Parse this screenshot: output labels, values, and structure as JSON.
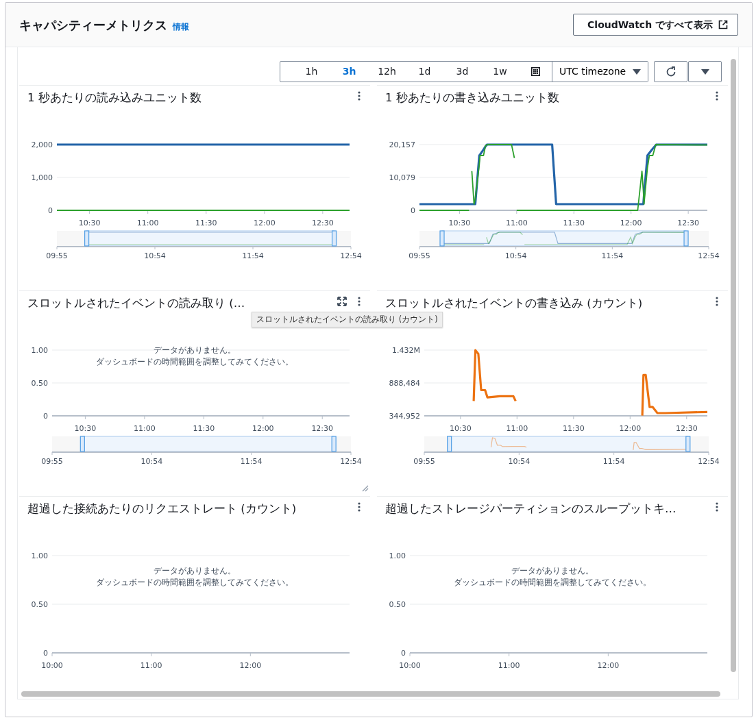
{
  "header": {
    "title": "キャパシティーメトリクス",
    "info_link": "情報",
    "cloudwatch_button": "CloudWatch ですべて表示"
  },
  "toolbar": {
    "ranges": [
      {
        "label": "1h",
        "selected": false
      },
      {
        "label": "3h",
        "selected": true
      },
      {
        "label": "12h",
        "selected": false
      },
      {
        "label": "1d",
        "selected": false
      },
      {
        "label": "3d",
        "selected": false
      },
      {
        "label": "1w",
        "selected": false
      }
    ],
    "timezone": "UTC timezone"
  },
  "widgets": [
    {
      "title": "1 秒あたりの読み込みユニット数",
      "hovered": false,
      "navigator_ticks": [
        "09:55",
        "10:54",
        "11:54",
        "12:54"
      ],
      "chart_data": {
        "type": "line",
        "x": [
          10.22,
          12.73
        ],
        "series": [
          {
            "color": "#2364a8",
            "values": [
              2000,
              2000
            ]
          },
          {
            "color": "#2ca02c",
            "values": [
              0,
              0
            ]
          }
        ],
        "xlim": [
          10.22,
          12.73
        ],
        "ylim": [
          0,
          2000
        ],
        "xticks": [
          {
            "value": 10.5,
            "label": "10:30"
          },
          {
            "value": 11,
            "label": "11:00"
          },
          {
            "value": 11.5,
            "label": "11:30"
          },
          {
            "value": 12,
            "label": "12:00"
          },
          {
            "value": 12.5,
            "label": "12:30"
          }
        ],
        "yticks": [
          {
            "value": 0,
            "label": "0"
          },
          {
            "value": 1000,
            "label": "1,000"
          },
          {
            "value": 2000,
            "label": "2,000"
          }
        ]
      }
    },
    {
      "title": "1 秒あたりの書き込みユニット数",
      "hovered": false,
      "navigator_ticks": [
        "09:55",
        "10:54",
        "11:54",
        "12:54"
      ],
      "chart_data": {
        "type": "line",
        "x": [
          10.15,
          10.583,
          10.597,
          10.608,
          10.627,
          10.638,
          10.673,
          10.68,
          10.71,
          10.728,
          10.74,
          10.745,
          10.917,
          10.955,
          10.98,
          10.992,
          11,
          11.31,
          11.345,
          12.058,
          12.095,
          12.107,
          12.113,
          12.143,
          12.16,
          12.19,
          12.217,
          12.22,
          12.667
        ],
        "series": [
          {
            "color": "#2364a8",
            "values": [
              1900,
              1900,
              1900,
              1900,
              1900,
              1900,
              16800,
              17100,
              18600,
              19600,
              20157,
              20157,
              20157,
              20157,
              20157,
              20157,
              20157,
              20157,
              1900,
              1900,
              1900,
              1900,
              4600,
              16800,
              17600,
              18900,
              20000,
              20157,
              20157
            ]
          },
          {
            "color": "#2ca02c",
            "values": [
              0,
              0,
              null,
              12000,
              1900,
              3500,
              14000,
              16800,
              16800,
              19800,
              20000,
              20157,
              20157,
              20157,
              16000,
              null,
              0,
              0,
              0,
              0,
              12000,
              6000,
              1900,
              13000,
              16800,
              16800,
              20157,
              20157,
              20000
            ]
          }
        ],
        "xlim": [
          10.15,
          12.667
        ],
        "ylim": [
          0,
          20157
        ],
        "xticks": [
          {
            "value": 10.5,
            "label": "10:30"
          },
          {
            "value": 11,
            "label": "11:00"
          },
          {
            "value": 11.5,
            "label": "11:30"
          },
          {
            "value": 12,
            "label": "12:00"
          },
          {
            "value": 12.5,
            "label": "12:30"
          }
        ],
        "yticks": [
          {
            "value": 0,
            "label": "0"
          },
          {
            "value": 10079,
            "label": "10,079"
          },
          {
            "value": 20157,
            "label": "20,157"
          }
        ]
      }
    },
    {
      "title": "スロットルされたイベントの読み取り (…",
      "hovered": true,
      "tooltip": "スロットルされたイベントの読み取り (カウント)",
      "navigator_ticks": [
        "09:55",
        "10:54",
        "11:54",
        "12:54"
      ],
      "no_data_message": [
        "データがありません。",
        "ダッシュボードの時間範囲を調整してみてください。"
      ],
      "chart_data": {
        "type": "line",
        "xlim": [
          10.22,
          12.73
        ],
        "ylim": [
          0,
          1
        ],
        "xticks": [
          {
            "value": 10.5,
            "label": "10:30"
          },
          {
            "value": 11,
            "label": "11:00"
          },
          {
            "value": 11.5,
            "label": "11:30"
          },
          {
            "value": 12,
            "label": "12:00"
          },
          {
            "value": 12.5,
            "label": "12:30"
          }
        ],
        "yticks": [
          {
            "value": 0,
            "label": "0"
          },
          {
            "value": 0.5,
            "label": "0.50"
          },
          {
            "value": 1,
            "label": "1.00"
          }
        ]
      }
    },
    {
      "title": "スロットルされたイベントの書き込み (カウント)",
      "hovered": false,
      "navigator_ticks": [
        "09:55",
        "10:54",
        "11:54",
        "12:54"
      ],
      "chart_data": {
        "type": "line",
        "x": [
          10.617,
          10.632,
          10.658,
          10.683,
          10.718,
          10.738,
          10.847,
          10.968,
          10.988,
          11.5,
          12.108,
          12.118,
          12.138,
          12.173,
          12.2,
          12.242,
          12.312,
          12.683
        ],
        "series": [
          {
            "color": "#ec7211",
            "values": [
              590000,
              1430000,
              1370000,
              770000,
              770000,
              650000,
              670000,
              670000,
              590000,
              null,
              350000,
              1020000,
              1020000,
              490000,
              490000,
              390000,
              390000,
              410000
            ]
          }
        ],
        "xlim": [
          10.18,
          12.683
        ],
        "ylim": [
          344952,
          1432000
        ],
        "xticks": [
          {
            "value": 10.5,
            "label": "10:30"
          },
          {
            "value": 11,
            "label": "11:00"
          },
          {
            "value": 11.5,
            "label": "11:30"
          },
          {
            "value": 12,
            "label": "12:00"
          },
          {
            "value": 12.5,
            "label": "12:30"
          }
        ],
        "yticks": [
          {
            "value": 344952,
            "label": "344,952"
          },
          {
            "value": 888484,
            "label": "888,484"
          },
          {
            "value": 1432000,
            "label": "1.432M"
          }
        ]
      }
    },
    {
      "title": "超過した接続あたりのリクエストレート (カウント)",
      "hovered": false,
      "no_data_message": [
        "データがありません。",
        "ダッシュボードの時間範囲を調整してみてください。"
      ],
      "chart_data": {
        "type": "line",
        "xlim": [
          10,
          13
        ],
        "ylim": [
          0,
          1
        ],
        "xticks": [
          {
            "value": 10,
            "label": "10:00"
          },
          {
            "value": 11,
            "label": "11:00"
          },
          {
            "value": 12,
            "label": "12:00"
          }
        ],
        "yticks": [
          {
            "value": 0,
            "label": "0"
          },
          {
            "value": 0.5,
            "label": "0.50"
          },
          {
            "value": 1,
            "label": "1.00"
          }
        ]
      }
    },
    {
      "title": "超過したストレージパーティションのスループットキ…",
      "hovered": false,
      "no_data_message": [
        "データがありません。",
        "ダッシュボードの時間範囲を調整してみてください。"
      ],
      "chart_data": {
        "type": "line",
        "xlim": [
          10,
          13
        ],
        "ylim": [
          0,
          1
        ],
        "xticks": [
          {
            "value": 10,
            "label": "10:00"
          },
          {
            "value": 11,
            "label": "11:00"
          },
          {
            "value": 12,
            "label": "12:00"
          }
        ],
        "yticks": [
          {
            "value": 0,
            "label": "0"
          },
          {
            "value": 0.5,
            "label": "0.50"
          },
          {
            "value": 1,
            "label": "1.00"
          }
        ]
      }
    }
  ]
}
